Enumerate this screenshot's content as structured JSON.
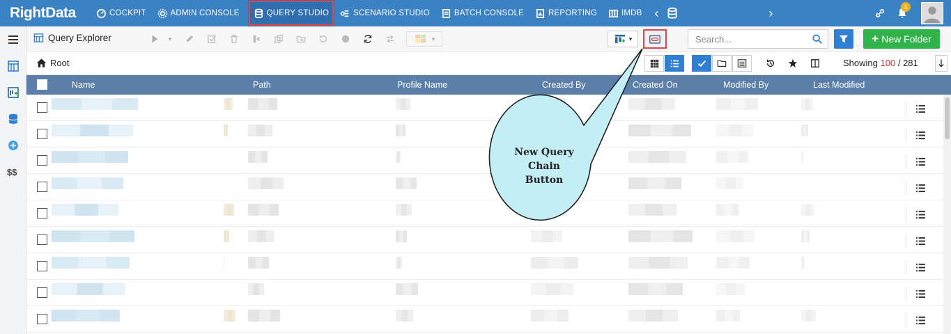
{
  "brand": {
    "name": "RightData"
  },
  "nav": {
    "items": [
      {
        "label": "COCKPIT",
        "icon": "cockpit-icon"
      },
      {
        "label": "ADMIN CONSOLE",
        "icon": "admin-gear-icon"
      },
      {
        "label": "QUERY STUDIO",
        "icon": "database-icon"
      },
      {
        "label": "SCENARIO STUDIO",
        "icon": "scenario-icon"
      },
      {
        "label": "BATCH CONSOLE",
        "icon": "batch-icon"
      },
      {
        "label": "REPORTING",
        "icon": "report-icon"
      },
      {
        "label": "IMDB",
        "icon": "imdb-icon"
      }
    ],
    "notification_count": "1"
  },
  "toolbar": {
    "title": "Query Explorer",
    "search_placeholder": "Search...",
    "new_folder_label": "New Folder"
  },
  "breadcrumb": {
    "root": "Root"
  },
  "paging": {
    "showing_label": "Showing",
    "shown": "100",
    "separator": "/",
    "total": "281"
  },
  "table": {
    "columns": [
      "Name",
      "Path",
      "Profile Name",
      "Created By",
      "Created On",
      "Modified By",
      "Last Modified"
    ]
  },
  "callout": {
    "line1": "New Query",
    "line2": "Chain",
    "line3": "Button"
  },
  "colors": {
    "nav": "#3b82c4",
    "header": "#5b7fa8",
    "accent_red": "#e04848",
    "green": "#30b44a",
    "blue": "#2f7fd4"
  }
}
